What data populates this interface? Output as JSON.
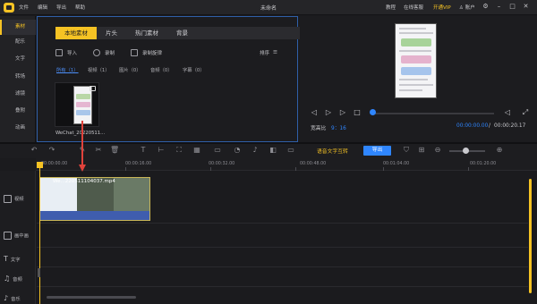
{
  "titlebar": {
    "menu": [
      "文件",
      "编辑",
      "导出",
      "帮助"
    ],
    "title": "未命名",
    "links": [
      "教程",
      "在线客服",
      "开通VIP",
      "账户"
    ],
    "window_controls": [
      "settings-icon",
      "minimize-icon",
      "maximize-icon",
      "close-icon"
    ]
  },
  "left_rail": {
    "items": [
      "素材",
      "配乐",
      "文字",
      "转场",
      "滤镜",
      "叠附",
      "动画"
    ],
    "active": 0
  },
  "media": {
    "tabs": [
      "本地素材",
      "片头",
      "热门素材",
      "背景"
    ],
    "tools": [
      "导入",
      "录制",
      "录制旋律"
    ],
    "sort_label": "排序",
    "filters": [
      "所有（1）",
      "视频（1）",
      "图片（0）",
      "音频（0）",
      "字幕（0）"
    ],
    "thumbnail_label": "WeChat_20220511..."
  },
  "preview": {
    "aspect_label": "宽高比",
    "aspect_value": "9：16",
    "time_current": "00:00:00.00",
    "time_separator": "/",
    "time_total": "00:00:20.17",
    "progress": 0.0
  },
  "toolbar": {
    "speech_to_text": "语音文字互转",
    "export": "导出"
  },
  "ruler": {
    "labels": [
      "00:00:00.00",
      "00:00:16.00",
      "00:00:32.00",
      "00:00:48.00",
      "00:01:04.00",
      "00:01:20.00"
    ]
  },
  "tracks": {
    "labels": [
      "视频",
      "画中画",
      "文字",
      "音频",
      "音乐"
    ]
  },
  "clip": {
    "title": "We...220511104037.mp4"
  },
  "colors": {
    "accent": "#f6c324",
    "primary": "#2f86ff",
    "annotation": "#e0423b"
  }
}
